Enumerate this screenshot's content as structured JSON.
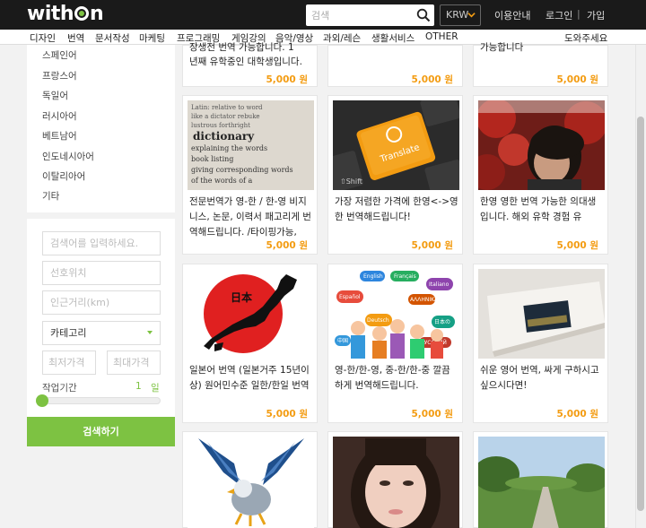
{
  "header": {
    "logo": "withmon",
    "search_placeholder": "검색",
    "currency": "KRW",
    "links": [
      "이용안내",
      "로그인",
      "가입"
    ]
  },
  "categories": [
    "디자인",
    "번역",
    "문서작성",
    "마케팅",
    "프로그래밍",
    "게임강의",
    "음악/영상",
    "과외/레슨",
    "생활서비스",
    "OTHER"
  ],
  "help_link": "도와주세요",
  "languages": [
    "스페인어",
    "프랑스어",
    "독일어",
    "러시아어",
    "베트남어",
    "인도네시아어",
    "이탈리아어",
    "기타"
  ],
  "filter": {
    "keyword_placeholder": "검색어를 입력하세요.",
    "location_placeholder": "선호위치",
    "distance_placeholder": "인근거리(km)",
    "category_value": "카테고리",
    "min_price_placeholder": "최저가격",
    "max_price_placeholder": "최대가격",
    "period_label": "작업기간",
    "period_value": "1",
    "period_unit": "일",
    "search_button": "검색하기"
  },
  "top_cards": [
    {
      "title_line1": "장생전 번역 가능합니다. 1",
      "title_line2": "년째 유학중인 대학생입니다.",
      "price": "5,000 원"
    },
    {
      "price": "5,000 원"
    },
    {
      "title_line1": "가능합니다",
      "price": "5,000 원"
    }
  ],
  "cards": [
    {
      "title": "전문번역가 영-한 / 한-영 비지니스, 논문, 이력서 패고리게 번역해드립니다. /타이핑가능,",
      "price": "5,000 원",
      "image": "dictionary"
    },
    {
      "title": "가장 저렴한 가격에 한영<->영한 번역해드립니다!",
      "price": "5,000 원",
      "image": "translate-key"
    },
    {
      "title": "한영 영한 번역 가능한 의대생입니다. 해외 유학 경험 유",
      "price": "5,000 원",
      "image": "portrait"
    },
    {
      "title": "일본어 번역 (일본거주 15년이상) 원어민수준 일한/한일 번역",
      "price": "5,000 원",
      "image": "japan-map"
    },
    {
      "title": "영-한/한-영, 중-한/한-중 깔끔하게 번역해드립니다.",
      "price": "5,000 원",
      "image": "speech-bubbles"
    },
    {
      "title": "쉬운 영어 번역, 싸게 구하시고 싶으시다면!",
      "price": "5,000 원",
      "image": "book"
    },
    {
      "image": "eagle"
    },
    {
      "image": "girl"
    },
    {
      "image": "park"
    }
  ],
  "bubble_words": [
    "English",
    "Français",
    "Español",
    "Italiano",
    "Deutsch",
    "日本の",
    "中国",
    "РУССКИЙ",
    "ΑΛΛΗΝΙΚΑ"
  ],
  "translate_key_text": "Translate",
  "dictionary_words": [
    "dictionary",
    "explaining the words",
    "book listing",
    "giving corresponding words"
  ],
  "japan_kanji": "日本",
  "colors": {
    "accent": "#7dc242",
    "price": "#f39c12",
    "topbar": "#1a1a1a"
  }
}
